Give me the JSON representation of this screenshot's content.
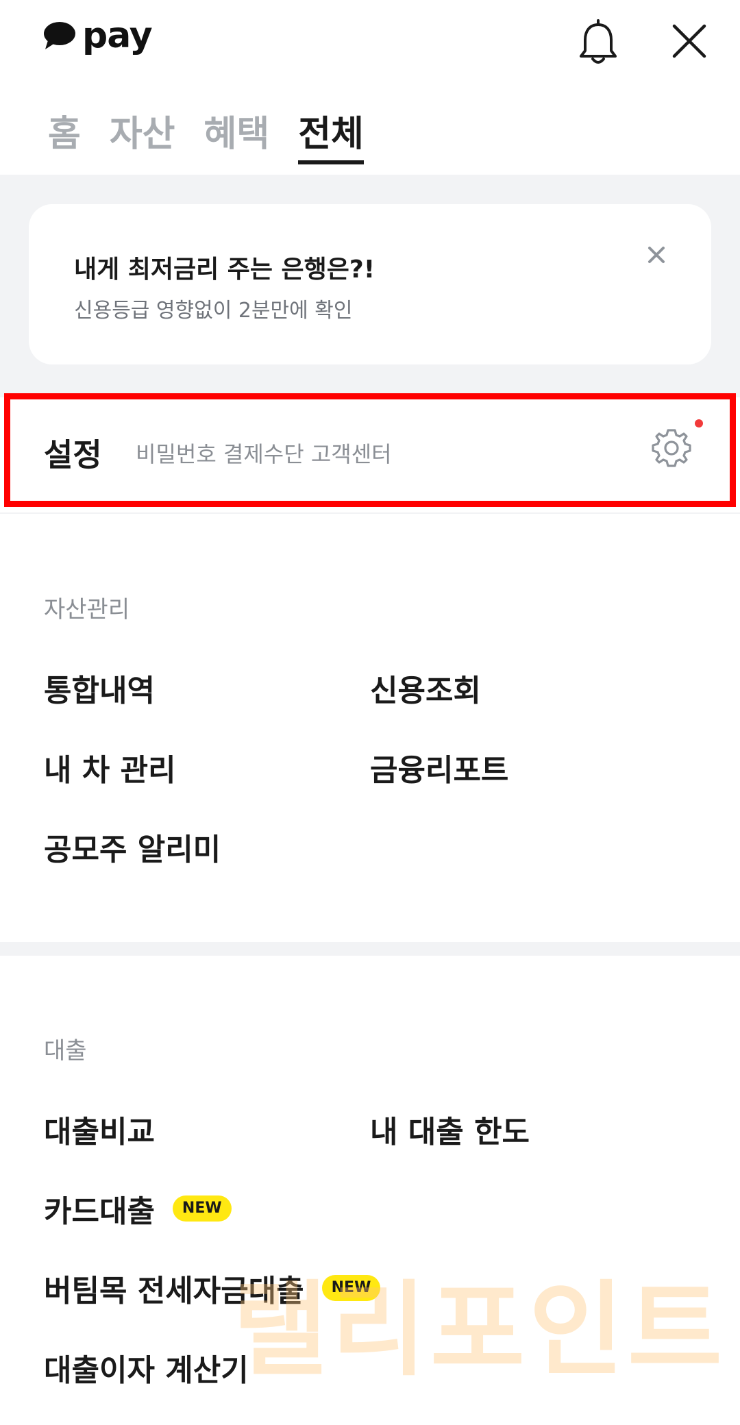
{
  "header": {
    "logo_text": "pay",
    "brand_color": "#111111",
    "icons": [
      "chat-bubble-icon",
      "bell-icon",
      "close-icon"
    ]
  },
  "tabs": [
    {
      "label": "홈",
      "active": false
    },
    {
      "label": "자산",
      "active": false
    },
    {
      "label": "혜택",
      "active": false
    },
    {
      "label": "전체",
      "active": true
    }
  ],
  "promo": {
    "title": "내게 최저금리 주는 은행은?!",
    "subtitle": "신용등급 영향없이 2분만에 확인"
  },
  "settings": {
    "title": "설정",
    "subtitle": "비밀번호 결제수단 고객센터",
    "highlight_color": "#ff0000",
    "notification_dot_color": "#f23a3a"
  },
  "asset_section": {
    "label": "자산관리",
    "items": [
      "통합내역",
      "신용조회",
      "내 차 관리",
      "금융리포트",
      "공모주 알리미"
    ]
  },
  "loan_section": {
    "label": "대출",
    "items": [
      {
        "label": "대출비교",
        "badge": ""
      },
      {
        "label": "내 대출 한도",
        "badge": ""
      },
      {
        "label": "카드대출",
        "badge": "NEW"
      },
      {
        "label": "버팀목 전세자금대출",
        "badge": "NEW"
      },
      {
        "label": "대출이자 계산기",
        "badge": ""
      }
    ],
    "badge_color": "#ffe812"
  },
  "watermark": "랠리포인트"
}
